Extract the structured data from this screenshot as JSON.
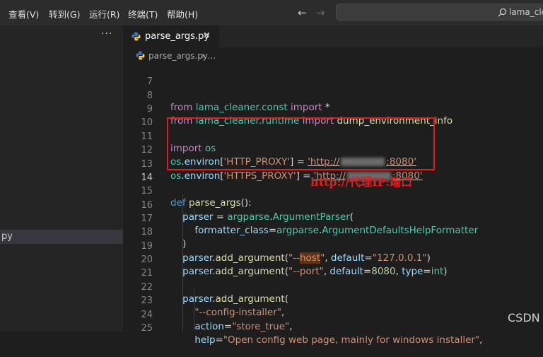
{
  "menu": [
    "查看(V)",
    "转到(G)",
    "运行(R)",
    "终端(T)",
    "帮助(H)"
  ],
  "search": {
    "text": "lama_clea"
  },
  "sidebar": {
    "more": "···",
    "file_label": "py"
  },
  "tab": {
    "label": "parse_args.py",
    "close": "✕"
  },
  "breadcrumb": {
    "file": "parse_args.py",
    "sep": "› ..."
  },
  "lines": {
    "l7": "7",
    "l8": "8",
    "l9": "9",
    "l10": "10",
    "l11": "11",
    "l12": "12",
    "l13": "13",
    "l14": "14",
    "l15": "15",
    "l16": "16",
    "l17": "17",
    "l18": "18",
    "l19": "19",
    "l20": "20",
    "l21": "21",
    "l22": "22",
    "l23": "23",
    "l24": "24",
    "l25": "25"
  },
  "code": {
    "from": "from",
    "import": "import",
    "mod_const": "lama_cleaner.const",
    "star": " *",
    "mod_runtime": "lama_cleaner.runtime",
    "dump": "dump_environment_info",
    "os": "os",
    "os_env": "os",
    "environ": "environ",
    "http_proxy": "'HTTP_PROXY'",
    "https_proxy": "'HTTPS_PROXY'",
    "http_val_start": "'http://",
    "http_val_end": ":8080'",
    "def": "def",
    "parse_args": "parse_args",
    "parser": "parser",
    "argparse": "argparse",
    "ArgumentParser": "ArgumentParser",
    "formatter_class": "formatter_class",
    "formatter_val": "ArgumentDefaultsHelpFormatter",
    "add_argument": "add_argument",
    "arg_host_a": "\"--",
    "arg_host_b": "host",
    "arg_host_c": "\"",
    "default": "default",
    "host_val": "\"127.0.0.1\"",
    "arg_port": "\"--port\"",
    "port_val": "8080",
    "type": "type",
    "int": "int",
    "config_installer": "\"--config-installer\"",
    "action": "action",
    "store_true": "\"store_true\"",
    "help": "help",
    "help_val": "\"Open config web page, mainly for windows installer\""
  },
  "annotation": "http://代理IP:端口",
  "watermark": "CSDN"
}
